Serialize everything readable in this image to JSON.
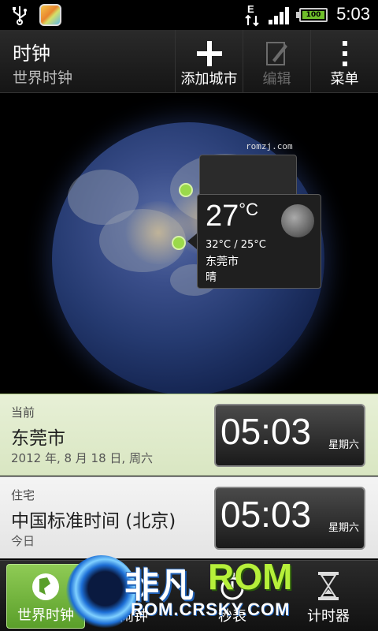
{
  "status_bar": {
    "network_type": "E",
    "battery_level": "100",
    "time": "5:03"
  },
  "action_bar": {
    "title": "时钟",
    "subtitle": "世界时钟",
    "add_city_label": "添加城市",
    "edit_label": "编辑",
    "menu_label": "菜单"
  },
  "globe": {
    "watermark": "romzj.com",
    "weather": {
      "temperature": "27",
      "unit": "°C",
      "high_low": "32°C / 25°C",
      "city": "东莞市",
      "condition": "晴"
    }
  },
  "cities": [
    {
      "caption": "当前",
      "name": "东莞市",
      "date": "2012 年, 8 月 18 日, 周六",
      "time": "05:03",
      "weekday": "星期六"
    },
    {
      "caption": "住宅",
      "name": "中国标准时间 (北京)",
      "date": "今日",
      "time": "05:03",
      "weekday": "星期六"
    }
  ],
  "tabs": [
    {
      "label": "世界时钟",
      "icon": "globe-icon",
      "selected": true
    },
    {
      "label": "闹钟",
      "icon": "alarm-icon",
      "selected": false
    },
    {
      "label": "秒表",
      "icon": "stopwatch-icon",
      "selected": false
    },
    {
      "label": "计时器",
      "icon": "hourglass-icon",
      "selected": false
    }
  ],
  "brand_overlay": {
    "name_cn": "非凡",
    "name_en": "ROM",
    "url": "ROM.CRSKY.COM"
  },
  "colors": {
    "accent_green": "#8fcb55",
    "current_row": "#e7f0d6"
  }
}
